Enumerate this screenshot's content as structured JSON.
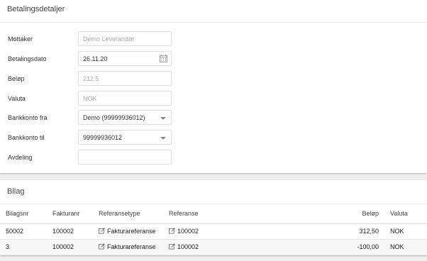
{
  "payment": {
    "title": "Betalingsdetaljer",
    "fields": {
      "mottaker": {
        "label": "Mottaker",
        "value": "Demo Leverandør"
      },
      "betalingsdato": {
        "label": "Betalingsdato",
        "value": "26.11.20"
      },
      "belop": {
        "label": "Beløp",
        "value": "212.5"
      },
      "valuta": {
        "label": "Valuta",
        "value": "NOK"
      },
      "bankkonto_fra": {
        "label": "Bankkonto fra",
        "value": "Demo (99999936012)"
      },
      "bankkonto_til": {
        "label": "Bankkonto til",
        "value": "99999936012"
      },
      "avdeling": {
        "label": "Avdeling",
        "value": ""
      }
    }
  },
  "bilag": {
    "title": "Bilag",
    "columns": {
      "bilagsnr": "Bilagsnr",
      "fakturanr": "Fakturanr",
      "referansetype": "Referansetype",
      "referanse": "Referanse",
      "belop": "Beløp",
      "valuta": "Valuta"
    },
    "rows": [
      {
        "bilagsnr": "50002",
        "fakturanr": "100002",
        "referansetype": "Fakturareferanse",
        "referanse": "100002",
        "belop": "312,50",
        "valuta": "NOK"
      },
      {
        "bilagsnr": "3",
        "fakturanr": "100002",
        "referansetype": "Fakturareferanse",
        "referanse": "100002",
        "belop": "-100,00",
        "valuta": "NOK"
      }
    ]
  },
  "icons": {
    "calendar": "calendar-icon",
    "dropdown": "chevron-down-icon",
    "edit": "edit-icon"
  }
}
